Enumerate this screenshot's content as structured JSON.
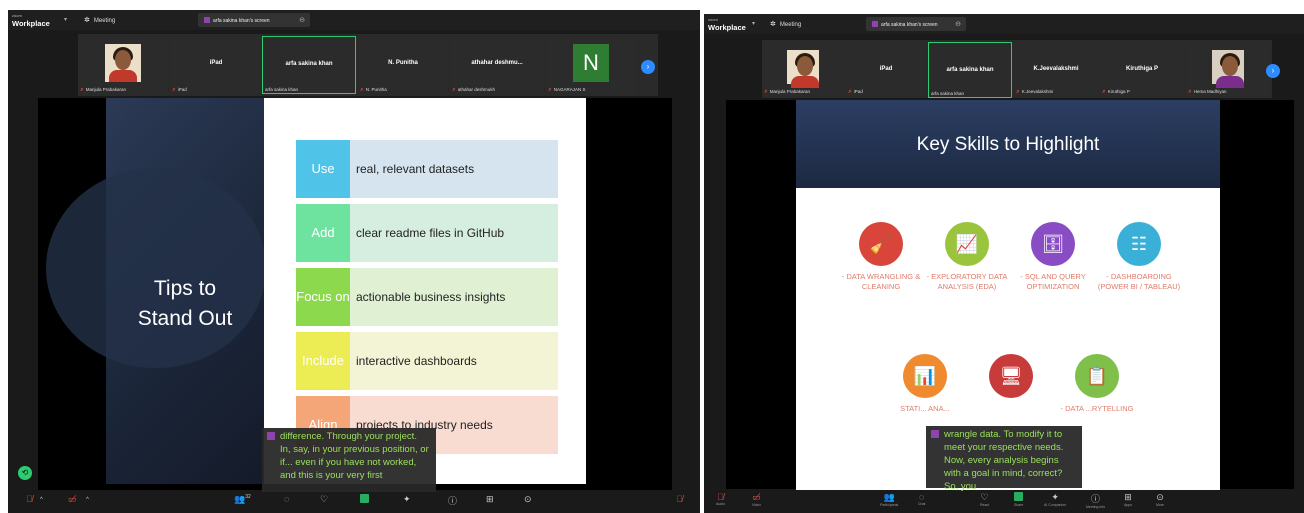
{
  "app": {
    "logo_small": "zoom",
    "logo_big": "Workplace",
    "meeting_label": "Meeting"
  },
  "left": {
    "screen_tab": "arfa sakina khan's screen",
    "tiles": [
      {
        "name": "",
        "footer": "Manjula Prabakaran"
      },
      {
        "name": "iPad",
        "footer": "iPad"
      },
      {
        "name": "arfa sakina khan",
        "footer": "arfa sakina khan"
      },
      {
        "name": "N. Punitha",
        "footer": "N. Punitha"
      },
      {
        "name": "athahar deshmu...",
        "footer": "athahar deshmukh"
      },
      {
        "name": "N",
        "footer": "NAGARAJAN S"
      }
    ],
    "slide": {
      "title_line1": "Tips to",
      "title_line2": "Stand Out",
      "rows": [
        {
          "key": "Use",
          "text": "real, relevant datasets",
          "key_color": "#4fc3e8",
          "bg": "#d5e4ee"
        },
        {
          "key": "Add",
          "text": "clear readme files in GitHub",
          "key_color": "#6ee3a0",
          "bg": "#d6eedf"
        },
        {
          "key": "Focus on",
          "text": "actionable business insights",
          "key_color": "#8cd94e",
          "bg": "#e0f1d3"
        },
        {
          "key": "Include",
          "text": "interactive dashboards",
          "key_color": "#ecec55",
          "bg": "#f3f4d5"
        },
        {
          "key": "Align",
          "text": "projects to industry needs",
          "key_color": "#f4a679",
          "bg": "#f8dcd2"
        }
      ]
    },
    "caption": "difference. Through your project. In, say, in your previous position, or if... even if you have not worked, and this is your very first",
    "toolbar": {
      "participants": "32"
    }
  },
  "right": {
    "screen_tab": "arfa sakina khan's screen",
    "tiles": [
      {
        "name": "",
        "footer": "Manjula Prabakaran"
      },
      {
        "name": "iPad",
        "footer": "iPad"
      },
      {
        "name": "arfa sakina khan",
        "footer": "arfa sakina khan"
      },
      {
        "name": "K.Jeevalakshmi",
        "footer": "K.Jeevalakshmi"
      },
      {
        "name": "Kiruthiga P",
        "footer": "Kiruthiga P"
      },
      {
        "name": "",
        "footer": "Hema Madhiyan"
      }
    ],
    "slide": {
      "title": "Key Skills to Highlight",
      "skills": [
        {
          "label": "- DATA WRANGLING & CLEANING",
          "color": "#d9453a",
          "icon": "broom-icon",
          "glyph": "🧹"
        },
        {
          "label": "- EXPLORATORY DATA ANALYSIS (EDA)",
          "color": "#9ac43b",
          "icon": "chart-icon",
          "glyph": "📈"
        },
        {
          "label": "- SQL AND QUERY OPTIMIZATION",
          "color": "#8a4cc4",
          "icon": "database-icon",
          "glyph": "🗄"
        },
        {
          "label": "- DASHBOARDING (POWER BI / TABLEAU)",
          "color": "#3ab0d9",
          "icon": "hierarchy-icon",
          "glyph": "☷"
        },
        {
          "label": "STATI... ANA...",
          "color": "#f08a2e",
          "icon": "bar-chart-icon",
          "glyph": "📊"
        },
        {
          "label": "",
          "color": "#c83b3b",
          "icon": "computer-icon",
          "glyph": "🖥"
        },
        {
          "label": "- DATA ...RYTELLING",
          "color": "#7fc04b",
          "icon": "report-icon",
          "glyph": "📋"
        }
      ]
    },
    "caption": "wrangle data. To modify it to meet your respective needs. Now, every analysis begins with a goal in mind, correct? So, you",
    "toolbar": {
      "participants": "33",
      "labels": [
        "Audio",
        "Video",
        "Participants",
        "Chat",
        "React",
        "Share",
        "AI Companion",
        "Meeting info",
        "Apps",
        "More"
      ]
    }
  }
}
